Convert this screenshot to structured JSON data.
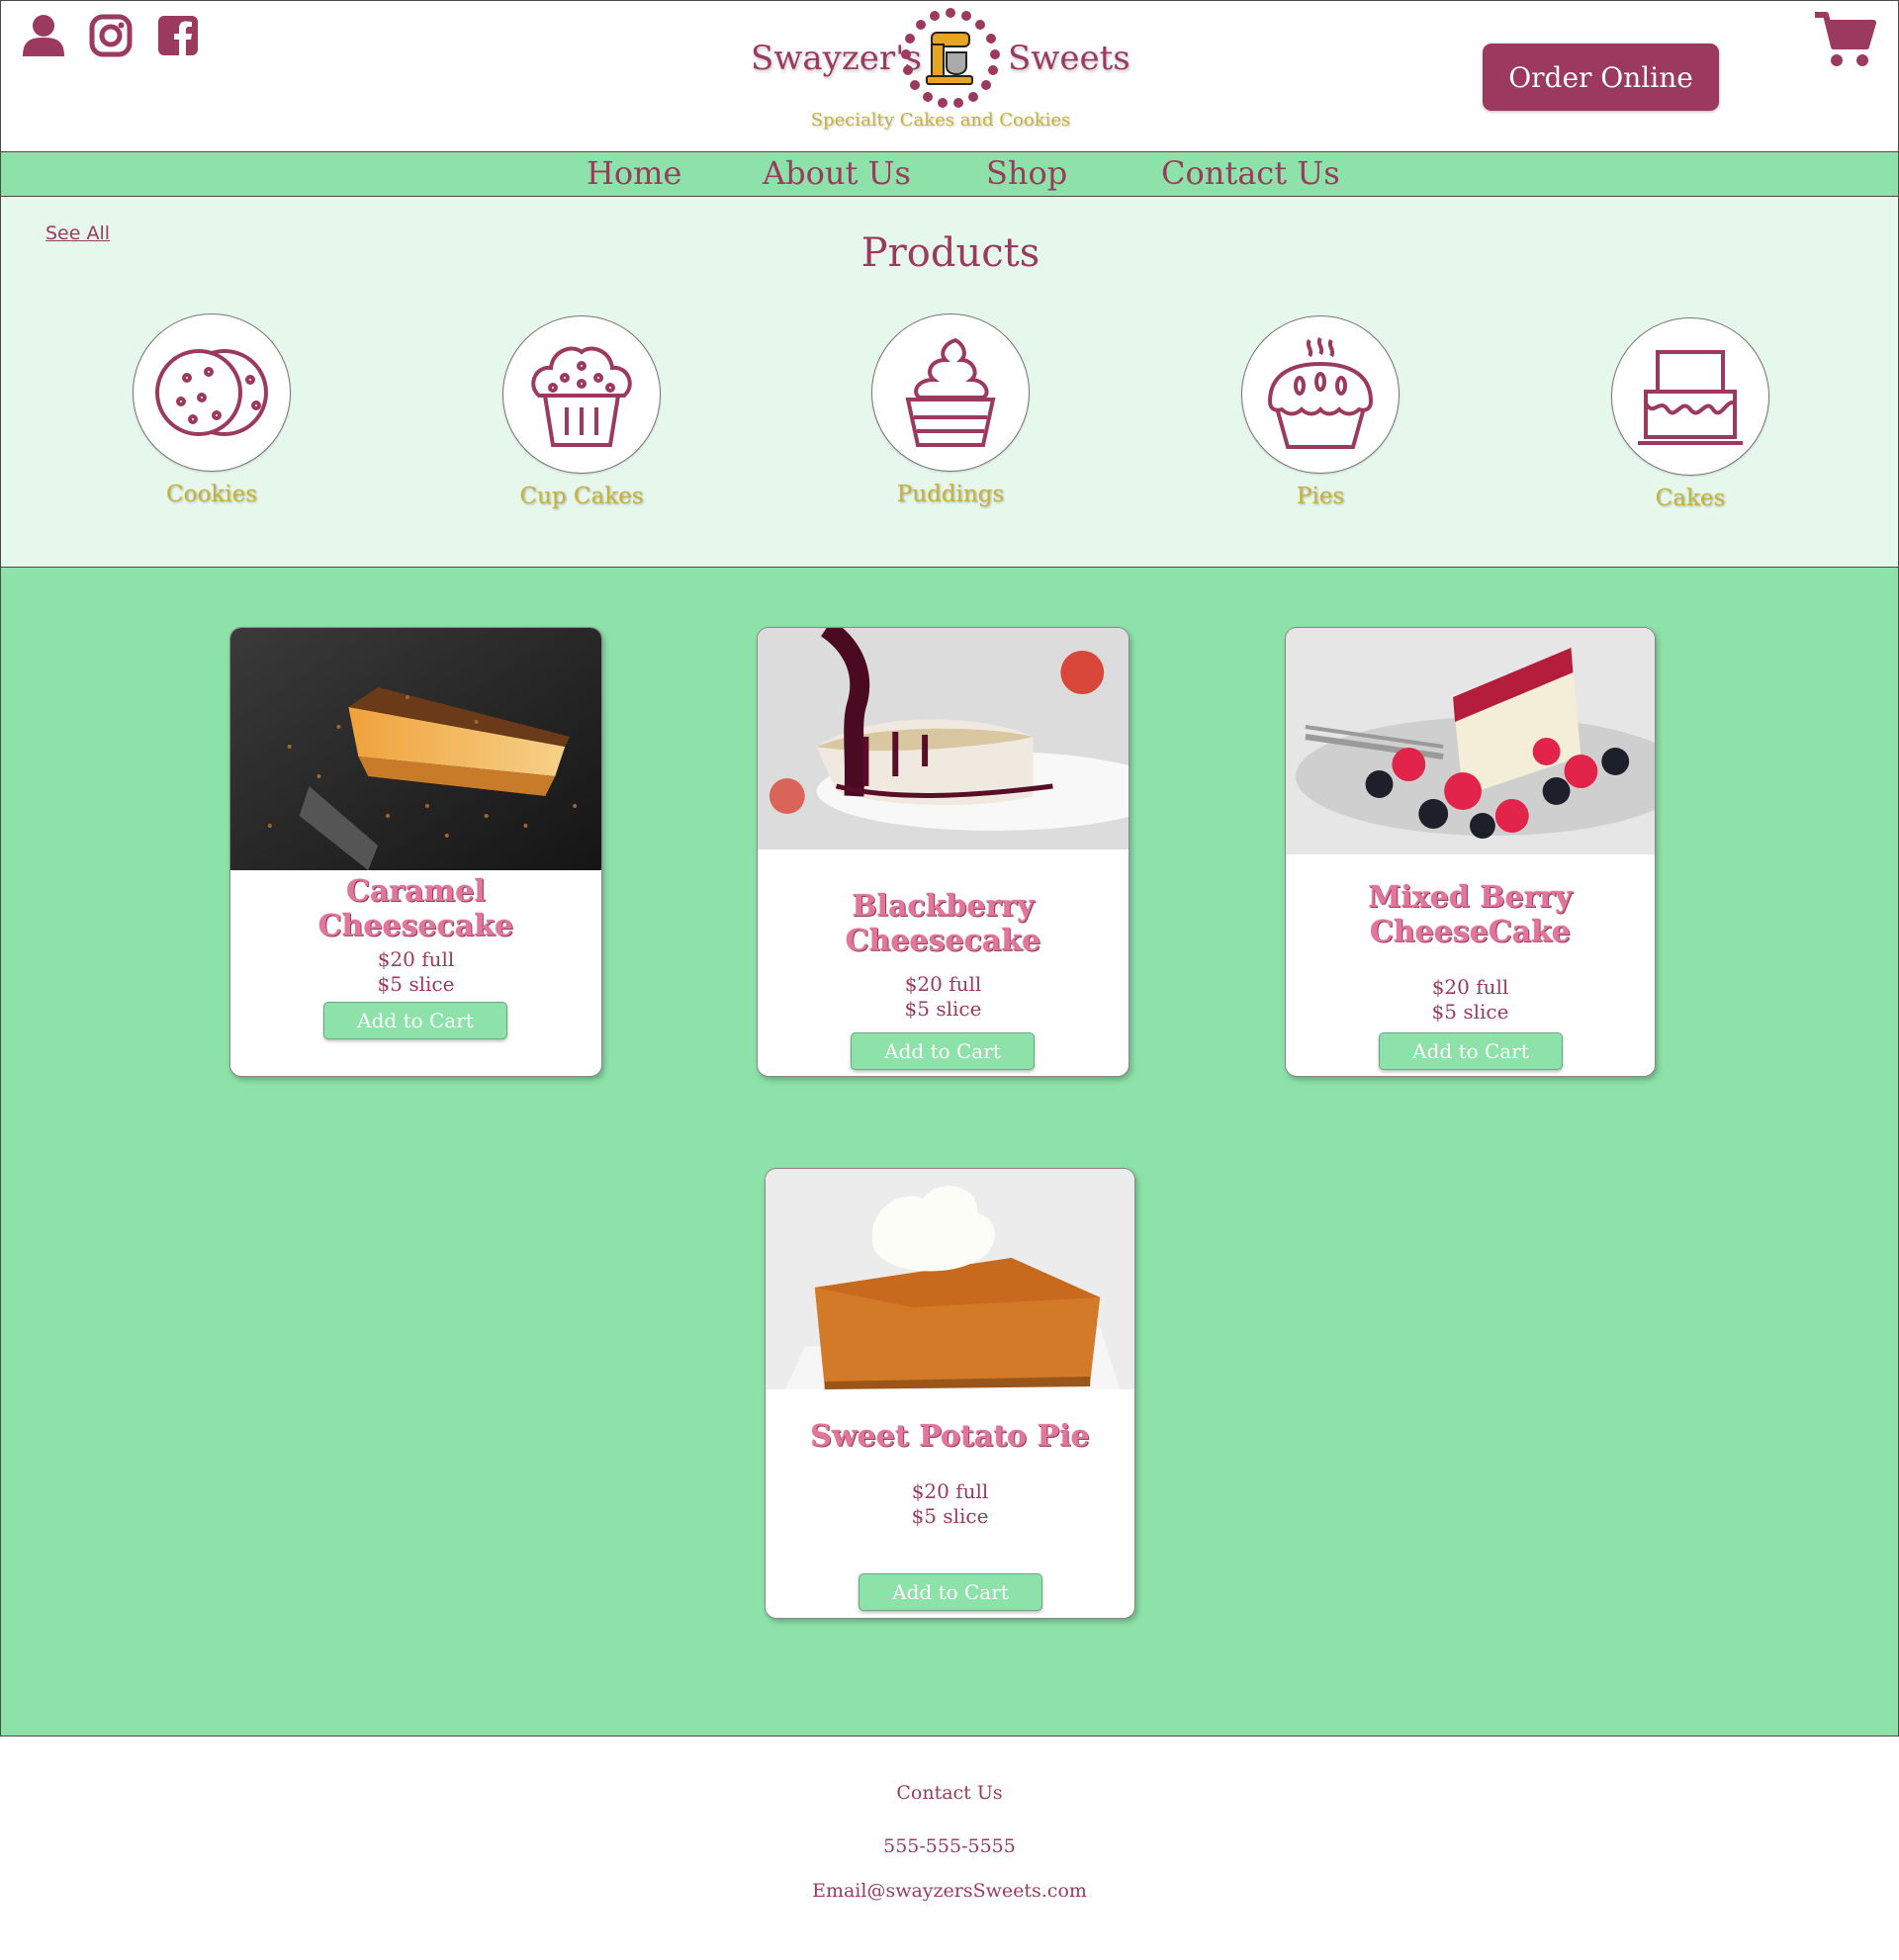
{
  "header": {
    "brand_left": "Swayzer's",
    "brand_right": "Sweets",
    "tagline": "Specialty Cakes and Cookies",
    "order_label": "Order Online",
    "icons": [
      "user-icon",
      "instagram-icon",
      "facebook-icon",
      "cart-icon"
    ]
  },
  "nav": {
    "items": [
      "Home",
      "About Us",
      "Shop",
      "Contact Us"
    ]
  },
  "products": {
    "see_all": "See All",
    "title": "Products",
    "categories": [
      {
        "label": "Cookies",
        "icon": "cookies-icon"
      },
      {
        "label": "Cup Cakes",
        "icon": "cupcake-icon"
      },
      {
        "label": "Puddings",
        "icon": "pudding-icon"
      },
      {
        "label": "Pies",
        "icon": "pie-icon"
      },
      {
        "label": "Cakes",
        "icon": "cake-icon"
      }
    ]
  },
  "cards": [
    {
      "name": "Caramel Cheesecake",
      "price_full": "$20 full",
      "price_slice": "$5 slice",
      "button": "Add to Cart"
    },
    {
      "name": "Blackberry Cheesecake",
      "price_full": "$20 full",
      "price_slice": "$5 slice",
      "button": "Add to Cart"
    },
    {
      "name": "Mixed Berry CheeseCake",
      "price_full": "$20 full",
      "price_slice": "$5 slice",
      "button": "Add to Cart"
    },
    {
      "name": "Sweet Potato Pie",
      "price_full": "$20 full",
      "price_slice": "$5 slice",
      "button": "Add to Cart"
    }
  ],
  "footer": {
    "heading": "Contact Us",
    "phone": "555-555-5555",
    "email": "Email@swayzersSweets.com"
  },
  "colors": {
    "brand": "#9b3a5e",
    "mint": "#8de2a9",
    "mint_light": "#e6f7ec",
    "gold": "#c9b23a",
    "card_title": "#e2769a"
  }
}
